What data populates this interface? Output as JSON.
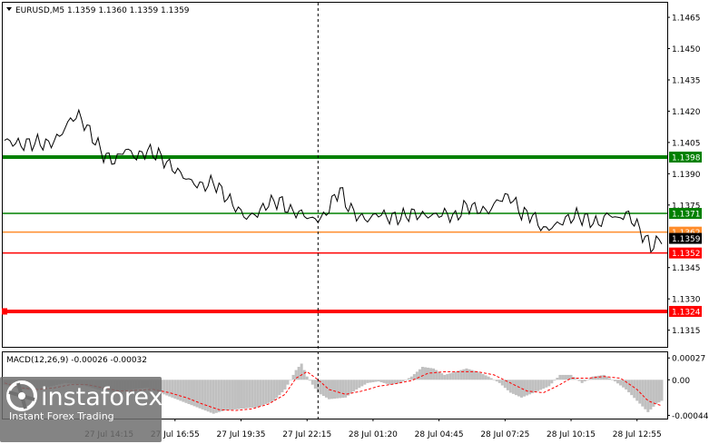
{
  "chart_data": {
    "type": "line",
    "symbol_header": "EURUSD,M5  1.1359 1.1360 1.1359 1.1359",
    "price_axis": {
      "ylim": [
        1.1307,
        1.1472
      ],
      "ticks": [
        "1.1465",
        "1.1450",
        "1.1435",
        "1.1420",
        "1.1405",
        "1.1390",
        "1.1375",
        "1.1345",
        "1.1330",
        "1.1315"
      ]
    },
    "time_axis": {
      "labels": [
        "27 Jul 14:15",
        "27 Jul 16:55",
        "27 Jul 19:35",
        "27 Jul 22:15",
        "28 Jul 01:20",
        "28 Jul 04:45",
        "28 Jul 07:25",
        "28 Jul 10:15",
        "28 Jul 12:55"
      ],
      "label_indices": [
        38,
        62,
        86,
        110,
        134,
        158,
        182,
        206,
        230
      ],
      "cursor_index": 114,
      "points": 240
    },
    "levels": [
      {
        "value": "1.1398",
        "color": "#008000",
        "thick": true
      },
      {
        "value": "1.1371",
        "color": "#008000",
        "thick": false
      },
      {
        "value": "1.1362",
        "color": "#ff8c2a",
        "thick": false
      },
      {
        "value": "1.1352",
        "color": "#ff0000",
        "thick": false
      },
      {
        "value": "1.1324",
        "color": "#ff0000",
        "thick": true
      }
    ],
    "current_price": "1.1359",
    "price_anchors": [
      [
        0,
        1.1406
      ],
      [
        6,
        1.1404
      ],
      [
        12,
        1.1405
      ],
      [
        16,
        1.1404
      ],
      [
        20,
        1.1408
      ],
      [
        24,
        1.1416
      ],
      [
        27,
        1.1418
      ],
      [
        31,
        1.141
      ],
      [
        36,
        1.1399
      ],
      [
        40,
        1.1396
      ],
      [
        44,
        1.1402
      ],
      [
        48,
        1.1398
      ],
      [
        52,
        1.1401
      ],
      [
        56,
        1.1399
      ],
      [
        60,
        1.1394
      ],
      [
        64,
        1.139
      ],
      [
        68,
        1.1386
      ],
      [
        72,
        1.1384
      ],
      [
        76,
        1.1386
      ],
      [
        80,
        1.138
      ],
      [
        84,
        1.1374
      ],
      [
        88,
        1.1369
      ],
      [
        92,
        1.1371
      ],
      [
        96,
        1.1376
      ],
      [
        100,
        1.1377
      ],
      [
        104,
        1.1372
      ],
      [
        108,
        1.1371
      ],
      [
        112,
        1.1368
      ],
      [
        116,
        1.1369
      ],
      [
        118,
        1.1374
      ],
      [
        122,
        1.1383
      ],
      [
        124,
        1.1376
      ],
      [
        128,
        1.137
      ],
      [
        132,
        1.1368
      ],
      [
        136,
        1.1371
      ],
      [
        140,
        1.1369
      ],
      [
        144,
        1.1369
      ],
      [
        148,
        1.1371
      ],
      [
        152,
        1.137
      ],
      [
        156,
        1.137
      ],
      [
        160,
        1.1371
      ],
      [
        164,
        1.1369
      ],
      [
        168,
        1.1375
      ],
      [
        172,
        1.1373
      ],
      [
        176,
        1.1372
      ],
      [
        180,
        1.1378
      ],
      [
        184,
        1.1379
      ],
      [
        188,
        1.1371
      ],
      [
        192,
        1.137
      ],
      [
        196,
        1.1363
      ],
      [
        200,
        1.1365
      ],
      [
        204,
        1.1368
      ],
      [
        208,
        1.137
      ],
      [
        212,
        1.1368
      ],
      [
        216,
        1.1366
      ],
      [
        220,
        1.1371
      ],
      [
        223,
        1.1368
      ],
      [
        226,
        1.1371
      ],
      [
        229,
        1.1367
      ],
      [
        232,
        1.1361
      ],
      [
        235,
        1.1355
      ],
      [
        237,
        1.1357
      ],
      [
        239,
        1.1359
      ]
    ],
    "macd": {
      "title": "MACD(12,26,9) -0.00026 -0.00032",
      "ylim": [
        -0.00048,
        0.00034
      ],
      "ticks": [
        "0.00027",
        "0.00",
        "-0.00044"
      ],
      "hist_anchors": [
        [
          0,
          -6e-05
        ],
        [
          6,
          -0.00012
        ],
        [
          12,
          -0.00013
        ],
        [
          16,
          -9e-05
        ],
        [
          22,
          -4e-05
        ],
        [
          28,
          -6e-05
        ],
        [
          34,
          -0.00012
        ],
        [
          40,
          -0.00016
        ],
        [
          46,
          -0.00012
        ],
        [
          52,
          -0.0001
        ],
        [
          58,
          -0.00018
        ],
        [
          64,
          -0.00026
        ],
        [
          70,
          -0.00034
        ],
        [
          76,
          -0.00042
        ],
        [
          80,
          -0.00038
        ],
        [
          86,
          -0.00036
        ],
        [
          92,
          -0.00034
        ],
        [
          98,
          -0.00026
        ],
        [
          102,
          -0.00012
        ],
        [
          106,
          0.00012
        ],
        [
          108,
          0.0002
        ],
        [
          110,
          4e-05
        ],
        [
          114,
          -0.00016
        ],
        [
          118,
          -0.00024
        ],
        [
          124,
          -0.00022
        ],
        [
          128,
          -0.00012
        ],
        [
          132,
          -4e-05
        ],
        [
          136,
          -2e-05
        ],
        [
          140,
          -6e-05
        ],
        [
          144,
          -4e-05
        ],
        [
          148,
          4e-05
        ],
        [
          152,
          0.00016
        ],
        [
          156,
          0.00014
        ],
        [
          160,
          6e-05
        ],
        [
          164,
          0.0001
        ],
        [
          168,
          0.00014
        ],
        [
          172,
          0.0001
        ],
        [
          176,
          4e-05
        ],
        [
          180,
          -4e-05
        ],
        [
          184,
          -0.00016
        ],
        [
          188,
          -0.00022
        ],
        [
          194,
          -0.00014
        ],
        [
          198,
          -8e-05
        ],
        [
          202,
          6e-05
        ],
        [
          206,
          6e-05
        ],
        [
          210,
          -4e-05
        ],
        [
          214,
          4e-05
        ],
        [
          218,
          6e-05
        ],
        [
          222,
          -2e-05
        ],
        [
          226,
          -0.00012
        ],
        [
          230,
          -0.00026
        ],
        [
          234,
          -0.0004
        ],
        [
          237,
          -0.0003
        ],
        [
          239,
          -0.00026
        ]
      ],
      "signal_anchors": [
        [
          0,
          -4e-05
        ],
        [
          6,
          -0.0001
        ],
        [
          12,
          -0.00012
        ],
        [
          18,
          -0.0001
        ],
        [
          24,
          -6e-05
        ],
        [
          30,
          -6e-05
        ],
        [
          36,
          -0.0001
        ],
        [
          42,
          -0.00014
        ],
        [
          48,
          -0.00013
        ],
        [
          54,
          -0.00012
        ],
        [
          60,
          -0.00016
        ],
        [
          66,
          -0.00022
        ],
        [
          72,
          -0.0003
        ],
        [
          78,
          -0.00037
        ],
        [
          84,
          -0.00038
        ],
        [
          90,
          -0.00036
        ],
        [
          96,
          -0.0003
        ],
        [
          102,
          -0.00018
        ],
        [
          106,
          2e-05
        ],
        [
          110,
          0.0001
        ],
        [
          114,
          0.0
        ],
        [
          118,
          -0.00012
        ],
        [
          124,
          -0.00018
        ],
        [
          130,
          -0.00014
        ],
        [
          136,
          -8e-05
        ],
        [
          142,
          -5e-05
        ],
        [
          148,
          -1e-05
        ],
        [
          154,
          8e-05
        ],
        [
          160,
          0.0001
        ],
        [
          166,
          0.0001
        ],
        [
          172,
          0.0001
        ],
        [
          178,
          6e-05
        ],
        [
          184,
          -4e-05
        ],
        [
          190,
          -0.00014
        ],
        [
          196,
          -0.00016
        ],
        [
          202,
          -6e-05
        ],
        [
          206,
          2e-05
        ],
        [
          212,
          2e-05
        ],
        [
          218,
          4e-05
        ],
        [
          224,
          2e-05
        ],
        [
          230,
          -0.00012
        ],
        [
          234,
          -0.00026
        ],
        [
          237,
          -0.0003
        ],
        [
          239,
          -0.00032
        ]
      ]
    }
  },
  "watermark": {
    "brand": "instaforex",
    "tagline": "Instant Forex Trading"
  },
  "colors": {
    "price_line": "#000000",
    "macd_hist": "#c0c0c0",
    "macd_signal": "#ff0000",
    "cursor": "#000000",
    "grid_border": "#000000"
  }
}
